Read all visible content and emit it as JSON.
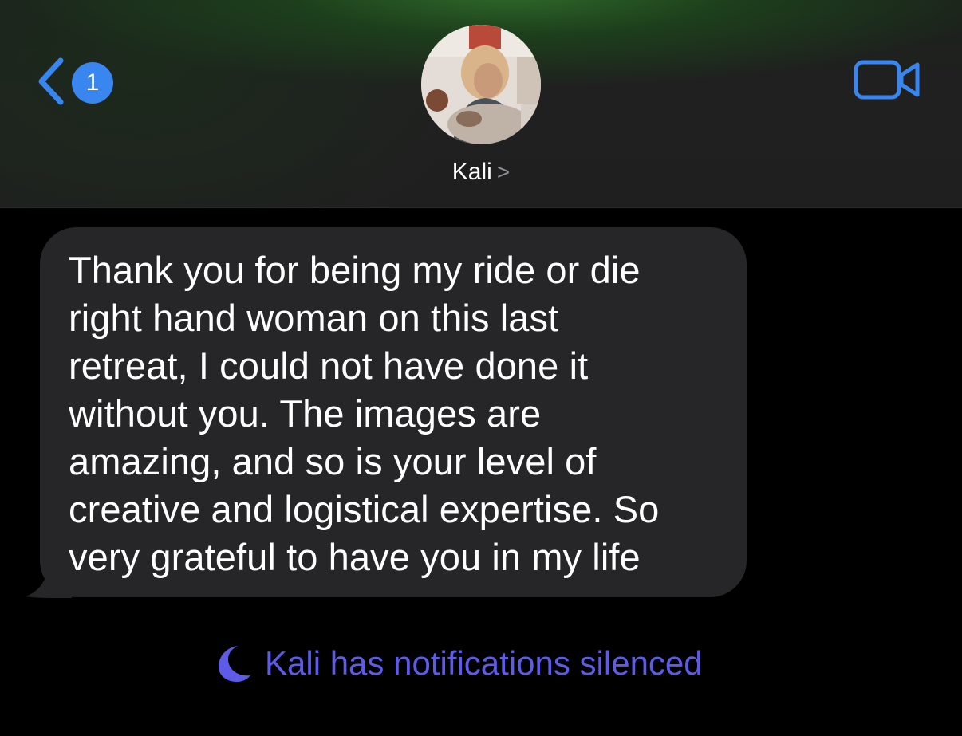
{
  "header": {
    "back_badge_count": "1",
    "contact_name": "Kali",
    "contact_chevron": ">"
  },
  "message": {
    "lines": [
      "Thank you for being my ride or die",
      "right hand woman on this last",
      "retreat, I could not have done it",
      "without you. The images are",
      "amazing, and so is your level of",
      "creative and logistical expertise. So",
      "very grateful to have you in my life"
    ]
  },
  "status": {
    "silenced_text": "Kali has notifications silenced"
  },
  "icons": {
    "back": "chevron-left-icon",
    "video": "video-camera-icon",
    "moon": "moon-icon"
  },
  "colors": {
    "accent_blue": "#3a86f0",
    "bubble": "#262628",
    "focus_purple": "#5e5ce6"
  }
}
